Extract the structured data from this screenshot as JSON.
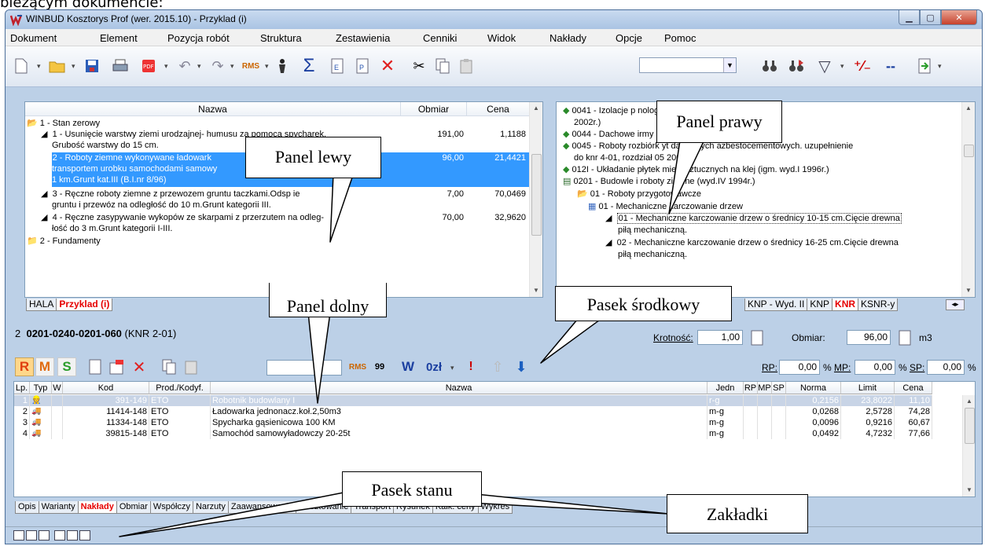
{
  "caption": "bieżącym dokumencie:",
  "window": {
    "title": "WINBUD Kosztorys Prof (wer. 2015.10) - Przyklad (i)"
  },
  "menu": [
    "Dokument",
    "Element",
    "Pozycja robót",
    "Struktura",
    "Zestawienia",
    "Cenniki",
    "Widok",
    "Nakłady",
    "Opcje",
    "Pomoc"
  ],
  "left_panel": {
    "headers": {
      "name": "Nazwa",
      "qty": "Obmiar",
      "price": "Cena"
    },
    "rows": [
      {
        "text": "1 - Stan zerowy",
        "qty": "",
        "price": ""
      },
      {
        "text": "1 - Usunięcie warstwy ziemi urodzajnej- humusu za pomocą spycharek.",
        "qty": "191,00",
        "price": "1,1188"
      },
      {
        "text": "Grubość warstwy do 15 cm.",
        "qty": "",
        "price": ""
      },
      {
        "text": "2 - Roboty ziemne wykonywane ładowark",
        "qty": "96,00",
        "price": "21,4421"
      },
      {
        "text": "transportem urobku samochodami samowy",
        "qty": "",
        "price": ""
      },
      {
        "text": "1 km.Grunt kat.III (B.I.nr 8/96)",
        "qty": "",
        "price": ""
      },
      {
        "text": "3 - Ręczne roboty ziemne z przewozem gruntu taczkami.Odsp      ie",
        "qty": "7,00",
        "price": "70,0469"
      },
      {
        "text": "gruntu i przewóz na odległość do 10 m.Grunt kategorii III.",
        "qty": "",
        "price": ""
      },
      {
        "text": "4 - Ręczne zasypywanie wykopów ze skarpami z przerzutem na odleg-",
        "qty": "70,00",
        "price": "32,9620"
      },
      {
        "text": "łość do 3 m.Grunt kategorii I-III.",
        "qty": "",
        "price": ""
      },
      {
        "text": "2 - Fundamenty",
        "qty": "",
        "price": ""
      }
    ],
    "tabs": [
      "HALA",
      "Przyklad (i)"
    ]
  },
  "right_panel": {
    "rows": [
      "0041 - Izolacje p                          nologii firmy deitermann (wyd.II",
      "2002r.)",
      "0044 - Dachowe                                       irmy deitermann (wyd.II 2002r.)",
      "0045 - Roboty rozbiórk         yt dachowych azbestocementowych. uzupełnienie",
      "do knr 4-01, rozdział 05        2004r.)",
      "012I - Układanie płytek        mieni sztucznych na klej (igm. wyd.I 1996r.)",
      "0201 - Budowle i roboty ziemne (wyd.IV 1994r.)",
      "01 - Roboty przygotowawcze",
      "01 - Mechaniczne karczowanie drzew",
      "01 - Mechaniczne karczowanie drzew o średnicy 10-15 cm.Cięcie drewna",
      "piłą mechaniczną.",
      "02 - Mechaniczne karczowanie drzew o średnicy 16-25 cm.Cięcie drewna",
      "piłą mechaniczną."
    ],
    "tabs": [
      "KNP - Wyd. II",
      "KNP",
      "KNR",
      "KSNR-y"
    ]
  },
  "position": {
    "number": "2",
    "code": "0201-0240-0201-060",
    "catalog": "(KNR 2-01)"
  },
  "krotnosc": {
    "label": "Krotność:",
    "value": "1,00"
  },
  "obmiar": {
    "label": "Obmiar:",
    "value": "96,00",
    "unit": "m3"
  },
  "lower_toolbar": {
    "r": "R",
    "m": "M",
    "s": "S",
    "w": "W",
    "zl": "0zł",
    "excl": "!",
    "rp_label": "RP:",
    "rp": "0,00",
    "mp_label": "MP:",
    "mp": "0,00",
    "sp_label": "SP:",
    "sp": "0,00",
    "pct": "%"
  },
  "grid": {
    "headers": [
      "Lp.",
      "Typ",
      "W",
      "Kod",
      "Prod./Kodyf.",
      "Nazwa",
      "Jedn",
      "RP",
      "MP",
      "SP",
      "Norma",
      "Limit",
      "Cena"
    ],
    "rows": [
      {
        "lp": "1",
        "kod": "391-149",
        "prod": "ETO",
        "nazwa": "Robotnik budowlany I",
        "jedn": "r-g",
        "norma": "0,2156",
        "limit": "23,8022",
        "cena": "11,10"
      },
      {
        "lp": "2",
        "kod": "11414-148",
        "prod": "ETO",
        "nazwa": "Ładowarka jednonacz.koł.2,50m3",
        "jedn": "m-g",
        "norma": "0,0268",
        "limit": "2,5728",
        "cena": "74,28"
      },
      {
        "lp": "3",
        "kod": "11334-148",
        "prod": "ETO",
        "nazwa": "Spycharka gąsienicowa 100 KM",
        "jedn": "m-g",
        "norma": "0,0096",
        "limit": "0,9216",
        "cena": "60,67"
      },
      {
        "lp": "4",
        "kod": "39815-148",
        "prod": "ETO",
        "nazwa": "Samochód samowyładowczy 20-25t",
        "jedn": "m-g",
        "norma": "0,0492",
        "limit": "4,7232",
        "cena": "77,66"
      }
    ]
  },
  "bottom_tabs": [
    "Opis",
    "Warianty",
    "Nakłady",
    "Obmiar",
    "Współczy",
    "Narzuty",
    "Zaawansowanie",
    "Rusztowanie",
    "Transport",
    "Rysunek",
    "Kalk. ceny",
    "Wykres"
  ],
  "callouts": {
    "left": "Panel lewy",
    "right": "Panel prawy",
    "bottom": "Panel dolny",
    "middle": "Pasek środkowy",
    "status": "Pasek stanu",
    "tabs": "Zakładki"
  }
}
